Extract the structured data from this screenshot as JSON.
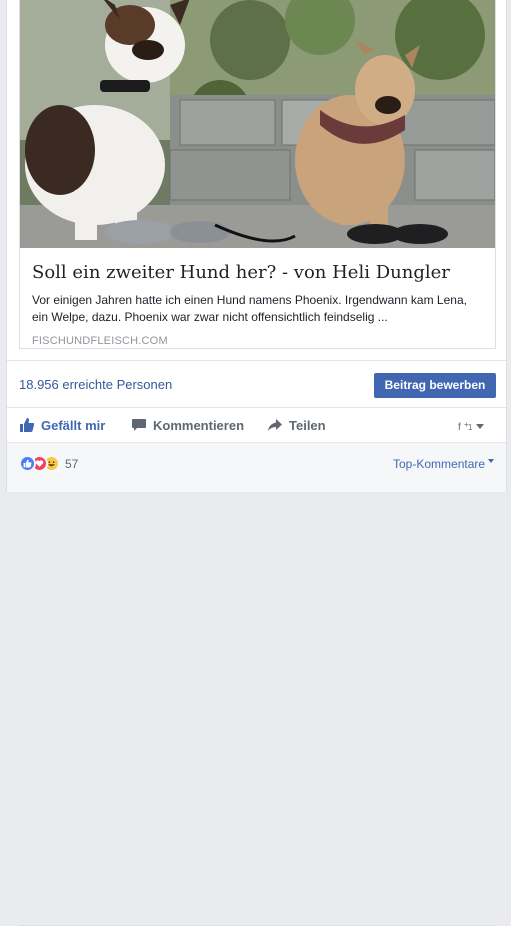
{
  "link": {
    "title": "Soll ein zweiter Hund her? - von Heli Dungler",
    "description": "Vor einigen Jahren hatte ich einen Hund namens Phoenix. Irgendwann kam Lena, ein Welpe, dazu. Phoenix war zwar nicht offensichtlich feindselig ...",
    "domain": "FISCHUNDFLEISCH.COM",
    "image_alt": "Two dogs sitting on a sidewalk next to sneakers"
  },
  "reach": {
    "text": "18.956 erreichte Personen",
    "boost_label": "Beitrag bewerben"
  },
  "actions": {
    "like": "Gefällt mir",
    "comment": "Kommentieren",
    "share": "Teilen"
  },
  "reactions": {
    "count": "57",
    "top_comments_label": "Top-Kommentare"
  },
  "colors": {
    "accent": "#4267b2",
    "link_blue": "#365899"
  }
}
